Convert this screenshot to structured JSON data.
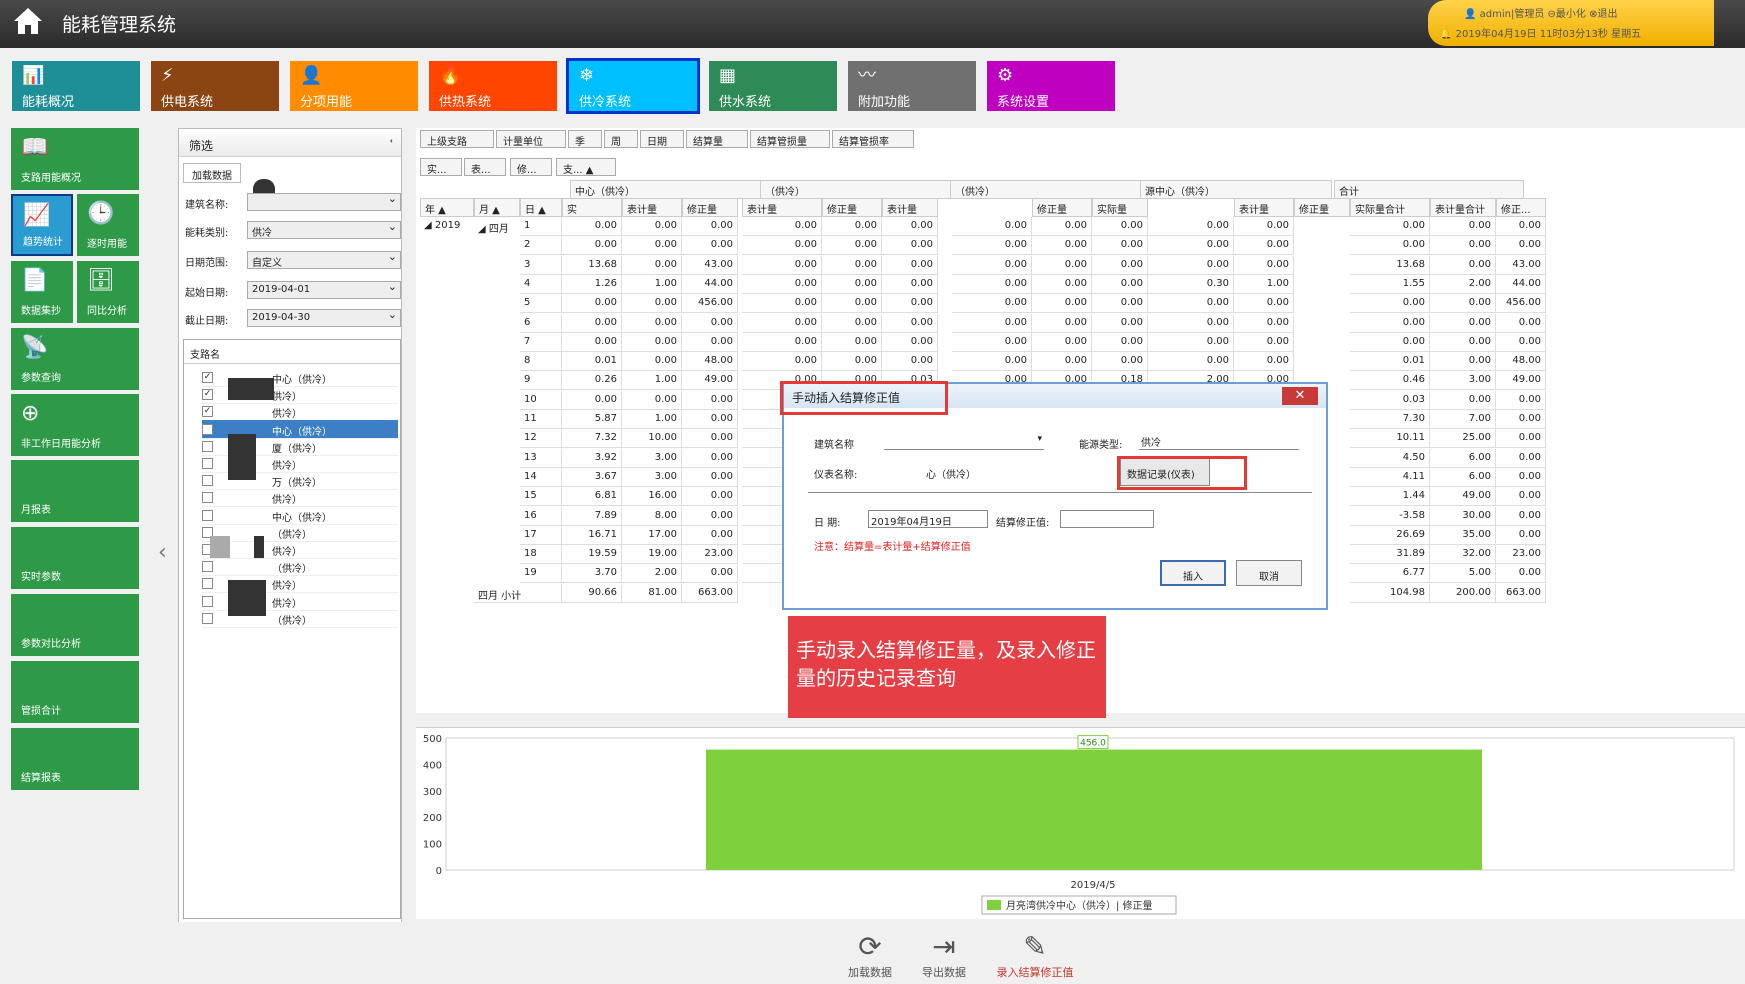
{
  "app": {
    "title": "能耗管理系统"
  },
  "user": {
    "info": "admin|管理员",
    "minimize": "最小化",
    "logout": "退出",
    "datetime": "2019年04月19日 11时03分13秒 星期五"
  },
  "modules": [
    {
      "label": "能耗概况",
      "color": "#1e8f96",
      "icon": "chart-icon"
    },
    {
      "label": "供电系统",
      "color": "#8b4513",
      "icon": "power-icon"
    },
    {
      "label": "分项用能",
      "color": "#ff8c00",
      "icon": "user-icon"
    },
    {
      "label": "供热系统",
      "color": "#ff4500",
      "icon": "flame-icon"
    },
    {
      "label": "供冷系统",
      "color": "#00bfff",
      "icon": "snowflake-icon"
    },
    {
      "label": "供水系统",
      "color": "#2e8b57",
      "icon": "grid-icon"
    },
    {
      "label": "附加功能",
      "color": "#707070",
      "icon": "pulse-icon"
    },
    {
      "label": "系统设置",
      "color": "#c000c0",
      "icon": "gear-icon"
    }
  ],
  "sidebar": [
    {
      "label": "支路用能概况"
    },
    {
      "label": "趋势统计"
    },
    {
      "label": "逐时用能"
    },
    {
      "label": "数据集抄"
    },
    {
      "label": "同比分析"
    },
    {
      "label": "参数查询"
    },
    {
      "label": "非工作日用能分析"
    },
    {
      "label": "月报表"
    },
    {
      "label": "实时参数"
    },
    {
      "label": "参数对比分析"
    },
    {
      "label": "管损合计"
    },
    {
      "label": "结算报表"
    }
  ],
  "filter": {
    "title": "筛选",
    "tab1": "加载数据",
    "tab2": "弓",
    "building_label": "建筑名称:",
    "energy_label": "能耗类别:",
    "energy_value": "供冷",
    "range_label": "日期范围:",
    "range_value": "自定义",
    "start_label": "起始日期:",
    "start_value": "2019-04-01",
    "end_label": "截止日期:",
    "end_value": "2019-04-30",
    "tree_header": "支路名",
    "tree_items": [
      {
        "label": "中心（供冷）",
        "checked": true
      },
      {
        "label": "供冷）",
        "checked": true
      },
      {
        "label": "供冷）",
        "checked": true
      },
      {
        "label": "中心（供冷）",
        "checked": true
      },
      {
        "label": "厦（供冷）",
        "checked": false
      },
      {
        "label": "供冷）",
        "checked": false
      },
      {
        "label": "万（供冷）",
        "checked": false
      },
      {
        "label": "供冷）",
        "checked": false
      },
      {
        "label": "中心（供冷）",
        "checked": false
      },
      {
        "label": "（供冷）",
        "checked": false
      },
      {
        "label": "供冷）",
        "checked": false
      },
      {
        "label": "（供冷）",
        "checked": false
      },
      {
        "label": "供冷）",
        "checked": false
      },
      {
        "label": "供冷）",
        "checked": false
      },
      {
        "label": "（供冷）",
        "checked": false
      }
    ]
  },
  "grid": {
    "group_buttons": [
      "上级支路",
      "计量单位",
      "季",
      "周",
      "日期",
      "结算量",
      "结算管损量",
      "结算管损率"
    ],
    "filter_buttons": [
      "实...",
      "表...",
      "修...",
      "支...  ▲"
    ],
    "date_headers": [
      "年  ▲",
      "月  ▲",
      "日  ▲"
    ],
    "group_headers": [
      "中心（供冷）",
      "（供冷）",
      "（供冷）",
      "源中心（供冷）",
      "合计"
    ],
    "sub_headers": [
      "实",
      "表计量",
      "修正量",
      "表计量",
      "修正量",
      "表计量",
      "修正量",
      "实际量",
      "表计量",
      "修正量",
      "实际量合计",
      "表计量合计",
      "修正..."
    ],
    "year": "2019",
    "month": "四月",
    "subtotal_label": "四月 小计",
    "rows": [
      [
        "1",
        "0.00",
        "0.00",
        "0.00",
        "0.00",
        "0.00",
        "0.00",
        "0.00",
        "0.00",
        "0.00",
        "0.00",
        "0.00",
        "0.00",
        "0.00",
        "0.00"
      ],
      [
        "2",
        "0.00",
        "0.00",
        "0.00",
        "0.00",
        "0.00",
        "0.00",
        "0.00",
        "0.00",
        "0.00",
        "0.00",
        "0.00",
        "0.00",
        "0.00",
        "0.00"
      ],
      [
        "3",
        "13.68",
        "0.00",
        "43.00",
        "0.00",
        "0.00",
        "0.00",
        "0.00",
        "0.00",
        "0.00",
        "0.00",
        "0.00",
        "13.68",
        "0.00",
        "43.00"
      ],
      [
        "4",
        "1.26",
        "1.00",
        "44.00",
        "0.00",
        "0.00",
        "0.00",
        "0.00",
        "0.00",
        "0.00",
        "0.30",
        "1.00",
        "1.55",
        "2.00",
        "44.00"
      ],
      [
        "5",
        "0.00",
        "0.00",
        "456.00",
        "0.00",
        "0.00",
        "0.00",
        "0.00",
        "0.00",
        "0.00",
        "0.00",
        "0.00",
        "0.00",
        "0.00",
        "456.00"
      ],
      [
        "6",
        "0.00",
        "0.00",
        "0.00",
        "0.00",
        "0.00",
        "0.00",
        "0.00",
        "0.00",
        "0.00",
        "0.00",
        "0.00",
        "0.00",
        "0.00",
        "0.00"
      ],
      [
        "7",
        "0.00",
        "0.00",
        "0.00",
        "0.00",
        "0.00",
        "0.00",
        "0.00",
        "0.00",
        "0.00",
        "0.00",
        "0.00",
        "0.00",
        "0.00",
        "0.00"
      ],
      [
        "8",
        "0.01",
        "0.00",
        "48.00",
        "0.00",
        "0.00",
        "0.00",
        "0.00",
        "0.00",
        "0.00",
        "0.00",
        "0.00",
        "0.01",
        "0.00",
        "48.00"
      ],
      [
        "9",
        "0.26",
        "1.00",
        "49.00",
        "0.00",
        "0.00",
        "0.03",
        "0.00",
        "0.00",
        "0.18",
        "2.00",
        "0.00",
        "0.46",
        "3.00",
        "49.00"
      ],
      [
        "10",
        "0.00",
        "0.00",
        "0.00",
        "",
        "",
        "",
        "",
        "",
        "",
        "",
        "",
        "0.03",
        "0.00",
        "0.00"
      ],
      [
        "11",
        "5.87",
        "1.00",
        "0.00",
        "",
        "",
        "",
        "",
        "",
        "",
        "",
        "",
        "7.30",
        "7.00",
        "0.00"
      ],
      [
        "12",
        "7.32",
        "10.00",
        "0.00",
        "",
        "",
        "",
        "",
        "",
        "",
        "",
        "",
        "10.11",
        "25.00",
        "0.00"
      ],
      [
        "13",
        "3.92",
        "3.00",
        "0.00",
        "",
        "",
        "",
        "",
        "",
        "",
        "",
        "",
        "4.50",
        "6.00",
        "0.00"
      ],
      [
        "14",
        "3.67",
        "3.00",
        "0.00",
        "",
        "",
        "",
        "",
        "",
        "",
        "",
        "",
        "4.11",
        "6.00",
        "0.00"
      ],
      [
        "15",
        "6.81",
        "16.00",
        "0.00",
        "",
        "",
        "",
        "",
        "",
        "",
        "",
        "",
        "1.44",
        "49.00",
        "0.00"
      ],
      [
        "16",
        "7.89",
        "8.00",
        "0.00",
        "",
        "",
        "",
        "",
        "",
        "",
        "",
        "",
        "-3.58",
        "30.00",
        "0.00"
      ],
      [
        "17",
        "16.71",
        "17.00",
        "0.00",
        "",
        "",
        "",
        "",
        "",
        "",
        "",
        "",
        "26.69",
        "35.00",
        "0.00"
      ],
      [
        "18",
        "19.59",
        "19.00",
        "23.00",
        "",
        "",
        "",
        "",
        "",
        "",
        "",
        "",
        "31.89",
        "32.00",
        "23.00"
      ],
      [
        "19",
        "3.70",
        "2.00",
        "0.00",
        "",
        "",
        "",
        "",
        "",
        "",
        "",
        "",
        "6.77",
        "5.00",
        "0.00"
      ]
    ],
    "subtotal": [
      "90.66",
      "81.00",
      "663.00",
      "104.98",
      "200.00",
      "663.00"
    ]
  },
  "dialog": {
    "title": "手动插入结算修正值",
    "building_label": "建筑名称",
    "energy_label": "能源类型:",
    "energy_value": "供冷",
    "meter_label": "仪表名称:",
    "meter_value": "心（供冷）",
    "record_button": "数据记录(仪表)",
    "date_label": "日    期:",
    "date_value": "2019年04月19日",
    "correction_label": "结算修正值:",
    "correction_value": "",
    "note": "注意：结算量=表计量+结算修正值",
    "insert_button": "插入",
    "cancel_button": "取消",
    "close": "✕"
  },
  "callout": {
    "text": "手动录入结算修正量，及录入修正量的历史记录查询"
  },
  "chart_data": {
    "type": "bar",
    "categories": [
      "2019/4/5"
    ],
    "series": [
      {
        "name": "月亮湾供冷中心（供冷）| 修正量",
        "values": [
          456.0
        ]
      }
    ],
    "data_label": "456.0",
    "y_ticks": [
      "500",
      "400",
      "300",
      "200",
      "100",
      "0"
    ],
    "ylim": [
      0,
      500
    ],
    "bar_color": "#7ed03c",
    "legend_position": "bottom"
  },
  "toolbar": [
    {
      "label": "加载数据",
      "icon": "refresh-icon",
      "color": "#555"
    },
    {
      "label": "导出数据",
      "icon": "export-icon",
      "color": "#555"
    },
    {
      "label": "录入结算修正值",
      "icon": "pen-icon",
      "color": "#c0392b"
    }
  ]
}
